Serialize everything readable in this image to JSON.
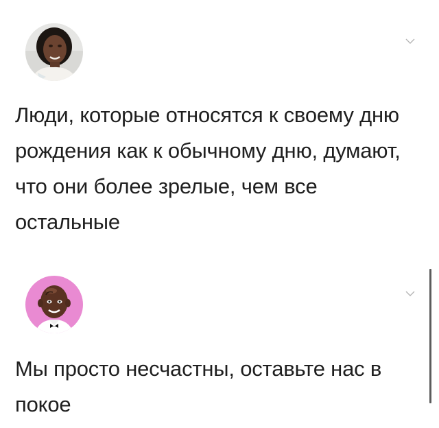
{
  "posts": [
    {
      "avatar": "avatar-woman-photo-icon",
      "text": "Люди, которые относятся к своему дню рождения как к обычному дню, думают, что они более зрелые, чем все остальные",
      "menu_icon": "chevron-down-icon"
    },
    {
      "avatar": "avatar-bald-man-cartoon-icon",
      "text": "Мы просто несчастны, оставьте нас в покое",
      "menu_icon": "chevron-down-icon"
    }
  ],
  "colors": {
    "background": "#ffffff",
    "text": "#1f1f1f",
    "chevron": "#b5b5b5",
    "avatar2_bg": "#e98ad2",
    "scrollbar": "#5c5c5c"
  }
}
